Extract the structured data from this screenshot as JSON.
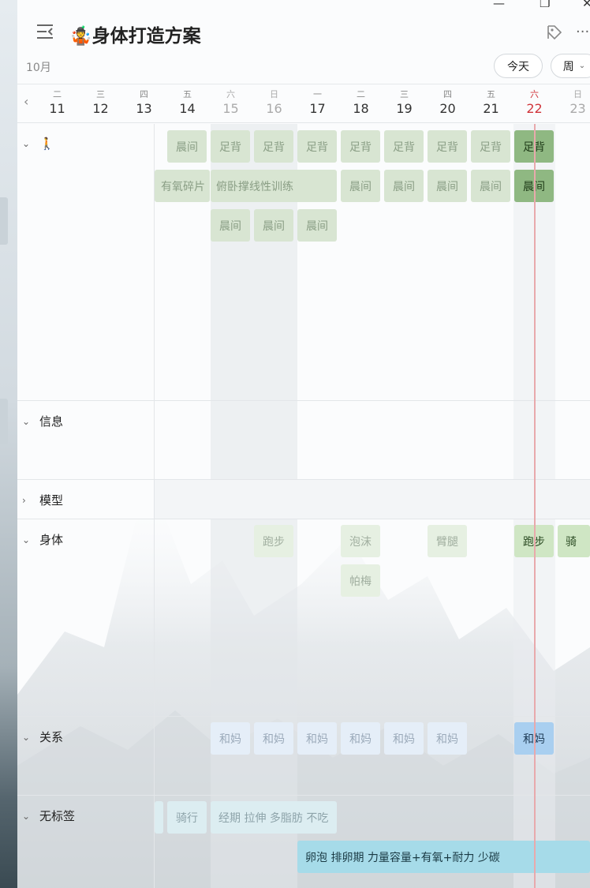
{
  "app": {
    "title": "身体打造方案",
    "title_emoji": "🤹",
    "month": "10月",
    "today_button": "今天",
    "view_button": "周",
    "window_controls": {
      "minimize": "—",
      "restore": "❐",
      "close": "✕"
    },
    "more": "···"
  },
  "days": [
    {
      "weekday": "二",
      "date": "11"
    },
    {
      "weekday": "三",
      "date": "12"
    },
    {
      "weekday": "四",
      "date": "13"
    },
    {
      "weekday": "五",
      "date": "14"
    },
    {
      "weekday": "六",
      "date": "15"
    },
    {
      "weekday": "日",
      "date": "16"
    },
    {
      "weekday": "一",
      "date": "17"
    },
    {
      "weekday": "二",
      "date": "18"
    },
    {
      "weekday": "三",
      "date": "19"
    },
    {
      "weekday": "四",
      "date": "20"
    },
    {
      "weekday": "五",
      "date": "21"
    },
    {
      "weekday": "六",
      "date": "22"
    },
    {
      "weekday": "日",
      "date": "23"
    }
  ],
  "lanes": {
    "emoji_lane": {
      "label": "🚶"
    },
    "info": {
      "label": "信息"
    },
    "model": {
      "label": "模型"
    },
    "body": {
      "label": "身体"
    },
    "relation": {
      "label": "关系"
    },
    "untagged": {
      "label": "无标签"
    }
  },
  "events": {
    "morning": "晨间",
    "foot_back": "足背",
    "cardio": "有氧碎片",
    "pushup": "俯卧撑线性训练",
    "run": "跑步",
    "foam": "泡沫",
    "pamei": "帕梅",
    "arm_leg": "臂腿",
    "ride_short": "骑",
    "mom": "和妈",
    "ride": "骑行",
    "period": "经期 拉伸 多脂肪 不吃",
    "ovulation": "卵泡 排卵期 力量容量+有氧+耐力 少碳"
  },
  "colors": {
    "accent_today": "#d0343a",
    "green_strong": "#8fb882",
    "blue_strong": "#a9cff0",
    "cyan_strong": "#a6dbe9"
  }
}
